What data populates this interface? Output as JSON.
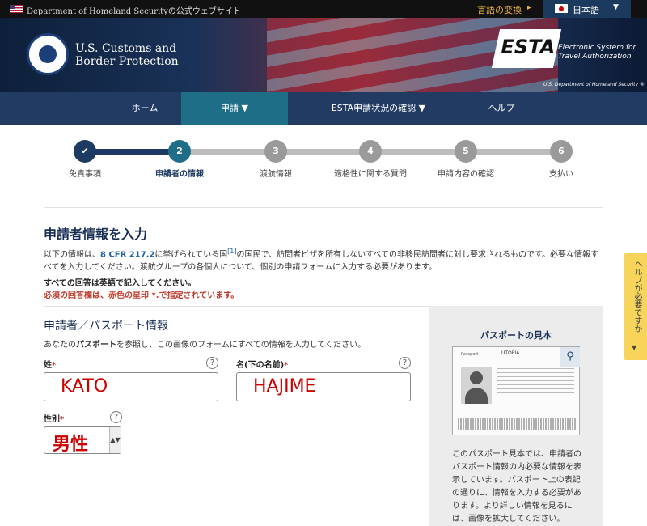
{
  "topbar": {
    "dhs_text": "Department of Homeland Securityの公式ウェブサイト",
    "lang_change": "言語の変換",
    "lang_caret": "▸",
    "lang_selected": "日本語",
    "lang_select_caret": "▼"
  },
  "header": {
    "cbp_line1": "U.S. Customs and",
    "cbp_line2": "Border Protection",
    "esta_logo": "ESTA",
    "esta_sub1": "Electronic System for",
    "esta_sub2": "Travel Authorization",
    "esta_dept": "U.S. Department of Homeland Security ®"
  },
  "nav": {
    "items": [
      {
        "label": "ホーム"
      },
      {
        "label": "申請 ▼"
      },
      {
        "label": "ESTA申請状況の確認 ▼"
      },
      {
        "label": "ヘルプ"
      }
    ]
  },
  "progress": {
    "steps": [
      {
        "num": "✔",
        "label": "免責事項"
      },
      {
        "num": "2",
        "label": "申請者の情報"
      },
      {
        "num": "3",
        "label": "渡航情報"
      },
      {
        "num": "4",
        "label": "適格性に関する質問"
      },
      {
        "num": "5",
        "label": "申請内容の確認"
      },
      {
        "num": "6",
        "label": "支払い"
      }
    ],
    "current": 2,
    "colors": {
      "done": "#1d3a63",
      "current": "#1d6e86",
      "todo": "#9a9a9a"
    }
  },
  "main": {
    "title": "申請者情報を入力",
    "intro_pre": "以下の情報は、",
    "intro_link": "8 CFR 217.2",
    "intro_mid": "に挙げられている国",
    "intro_sup": "[1]",
    "intro_post": "の国民で、訪問者ビザを所有しないすべての非移民訪問者に対し要求されるものです。必要な情報すべてを入力してください。渡航グループの各個人について、個別の申請フォームに入力する必要があります。",
    "req_english": "すべての回答は英語で記入してください。",
    "req_star": "必須の回答欄は、赤色の星印 *.で指定されています。"
  },
  "form": {
    "section_title": "申請者／パスポート情報",
    "section_desc_pre": "あなたの",
    "section_desc_bold": "パスポート",
    "section_desc_post": "を参照し、この画像のフォームにすべての情報を入力してください。",
    "surname_label": "姓",
    "surname_value": "KATO",
    "given_label": "名(下の名前)",
    "given_value": "HAJIME",
    "gender_label": "性別",
    "gender_value": "男性",
    "star": "*",
    "help_glyph": "?"
  },
  "sample": {
    "title": "パスポートの見本",
    "passport_label": "Passport",
    "utopia": "UTOPIA",
    "description": "このパスポート見本では、申請者のパスポート情報の内必要な情報を表示しています。パスポート上の表記の通りに、情報を入力する必要があります。より詳しい情報を見るには、画像を拡大してください。"
  },
  "helptab": {
    "label": "ヘルプが必要ですか",
    "caret": "▼"
  }
}
